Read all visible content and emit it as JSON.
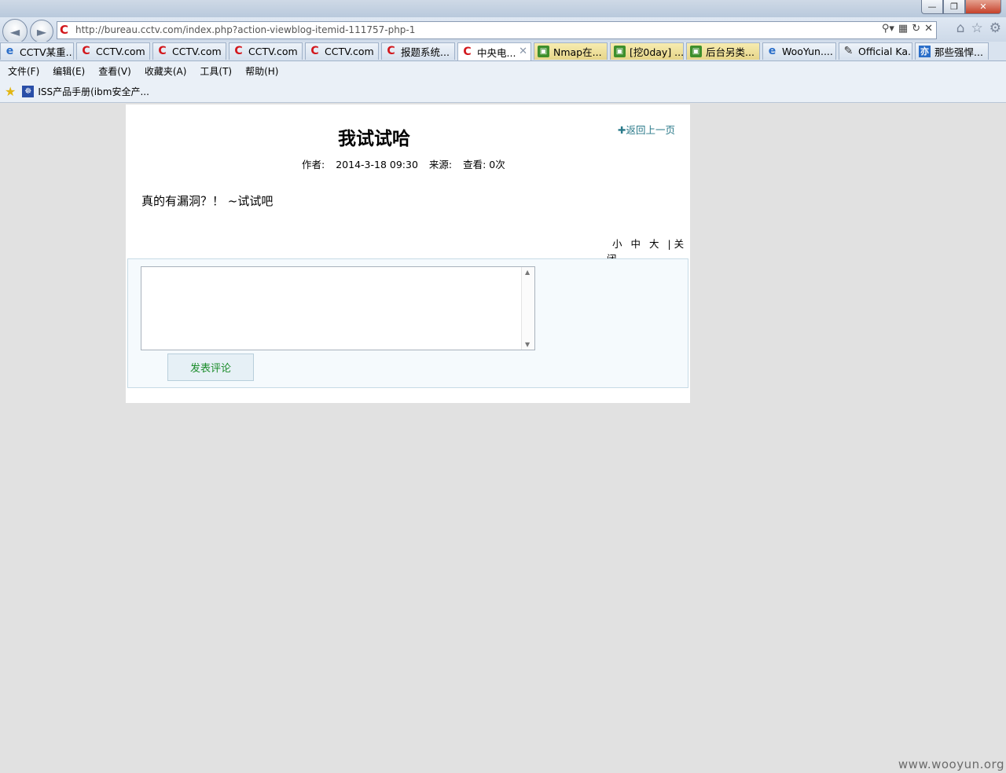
{
  "window": {
    "min_label": "—",
    "max_label": "❐",
    "close_label": "✕"
  },
  "nav": {
    "back_icon": "◄",
    "forward_icon": "►",
    "url": "http://bureau.cctv.com/index.php?action-viewblog-itemid-111757-php-1",
    "site_logo": "C",
    "tool_icons": [
      "⚲▾",
      "▦",
      "↻",
      "✕"
    ],
    "right_icons": [
      "⌂",
      "☆",
      "⚙"
    ]
  },
  "tabs": [
    {
      "icon": "ie",
      "label": "CCTV某重..."
    },
    {
      "icon": "c",
      "label": "CCTV.com"
    },
    {
      "icon": "c",
      "label": "CCTV.com"
    },
    {
      "icon": "c",
      "label": "CCTV.com"
    },
    {
      "icon": "c",
      "label": "CCTV.com"
    },
    {
      "icon": "c",
      "label": "报题系统..."
    },
    {
      "icon": "c",
      "label": "中央电...",
      "active": true
    },
    {
      "icon": "s",
      "label": "Nmap在..."
    },
    {
      "icon": "s",
      "label": "[挖0day] ..."
    },
    {
      "icon": "s",
      "label": "后台另类..."
    },
    {
      "icon": "ie",
      "label": "WooYun...."
    },
    {
      "icon": "k",
      "label": "Official Ka..."
    },
    {
      "icon": "zh",
      "label": "那些强悍..."
    }
  ],
  "menu": [
    "文件(F)",
    "编辑(E)",
    "查看(V)",
    "收藏夹(A)",
    "工具(T)",
    "帮助(H)"
  ],
  "favorites": {
    "item_label": "ISS产品手册(ibm安全产..."
  },
  "article": {
    "title": "我试试哈",
    "back_link": "返回上一页",
    "author_label": "作者:",
    "date": "2014-3-18 09:30",
    "source_label": "来源:",
    "views": "查看: 0次",
    "content": "真的有漏洞？！ ~试试吧",
    "font_small": "小",
    "font_medium": "中",
    "font_large": "大",
    "close": "| 关闭"
  },
  "comment": {
    "submit_label": "发表评论"
  },
  "watermark": "www.wooyun.org"
}
